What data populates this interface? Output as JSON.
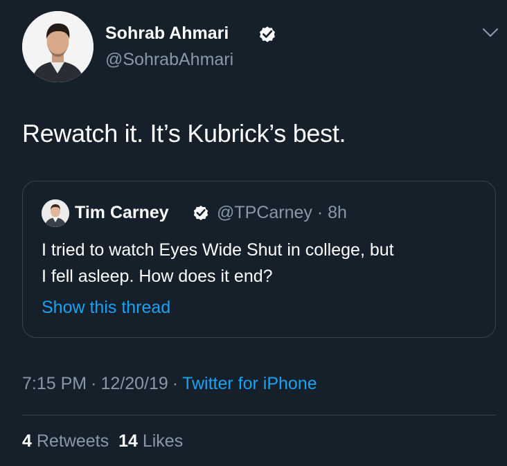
{
  "author": {
    "display_name": "Sohrab Ahmari",
    "handle": "@SohrabAhmari",
    "verified": true,
    "avatar_icon": "profile-photo"
  },
  "tweet": {
    "text": "Rewatch it. It’s Kubrick’s best."
  },
  "quoted_tweet": {
    "display_name": "Tim Carney",
    "handle": "@TPCarney",
    "time_ago": "8h",
    "verified": true,
    "text_lines": [
      "I tried to watch Eyes Wide Shut in college, but",
      "I fell asleep. How does it end?"
    ],
    "thread_link": "Show this thread"
  },
  "meta": {
    "time": "7:15 PM",
    "date": "12/20/19",
    "separator": "·",
    "source": "Twitter for iPhone"
  },
  "stats": {
    "retweets_count": "4",
    "retweets_label": "Retweets",
    "likes_count": "14",
    "likes_label": "Likes"
  },
  "colors": {
    "background": "#15202b",
    "primary_text": "#ffffff",
    "secondary_text": "#8899a6",
    "accent": "#1da1f2",
    "border": "#38444d"
  }
}
